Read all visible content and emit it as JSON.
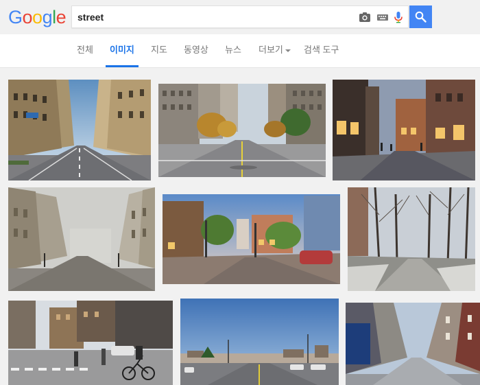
{
  "logo": {
    "letters": [
      {
        "ch": "G",
        "color": "#4285f4"
      },
      {
        "ch": "o",
        "color": "#ea4335"
      },
      {
        "ch": "o",
        "color": "#fbbc05"
      },
      {
        "ch": "g",
        "color": "#4285f4"
      },
      {
        "ch": "l",
        "color": "#34a853"
      },
      {
        "ch": "e",
        "color": "#ea4335"
      }
    ]
  },
  "search": {
    "query": "street",
    "icons": [
      "camera-icon",
      "keyboard-icon",
      "microphone-icon"
    ],
    "button_icon": "search-icon"
  },
  "nav": {
    "items": [
      {
        "label": "전체",
        "active": false
      },
      {
        "label": "이미지",
        "active": true
      },
      {
        "label": "지도",
        "active": false
      },
      {
        "label": "동영상",
        "active": false
      },
      {
        "label": "뉴스",
        "active": false
      },
      {
        "label": "더보기",
        "active": false,
        "dropdown": true
      },
      {
        "label": "검색 도구",
        "active": false
      }
    ]
  },
  "results": {
    "images": [
      {
        "subject": "wide avenue with ornate buildings and road markings"
      },
      {
        "subject": "city avenue lined with autumn trees"
      },
      {
        "subject": "evening cobblestone street with lit shopfronts"
      },
      {
        "subject": "foggy street with classic facades"
      },
      {
        "subject": "HDR city intersection at dusk"
      },
      {
        "subject": "winter park path with bare trees"
      },
      {
        "subject": "busy crosswalk with a cyclist"
      },
      {
        "subject": "suburban road under blue sky"
      },
      {
        "subject": "narrow pedestrian shopping street"
      }
    ]
  },
  "colors": {
    "accent": "#1a73e8",
    "search_button": "#4285f4",
    "background": "#f1f1f1"
  }
}
